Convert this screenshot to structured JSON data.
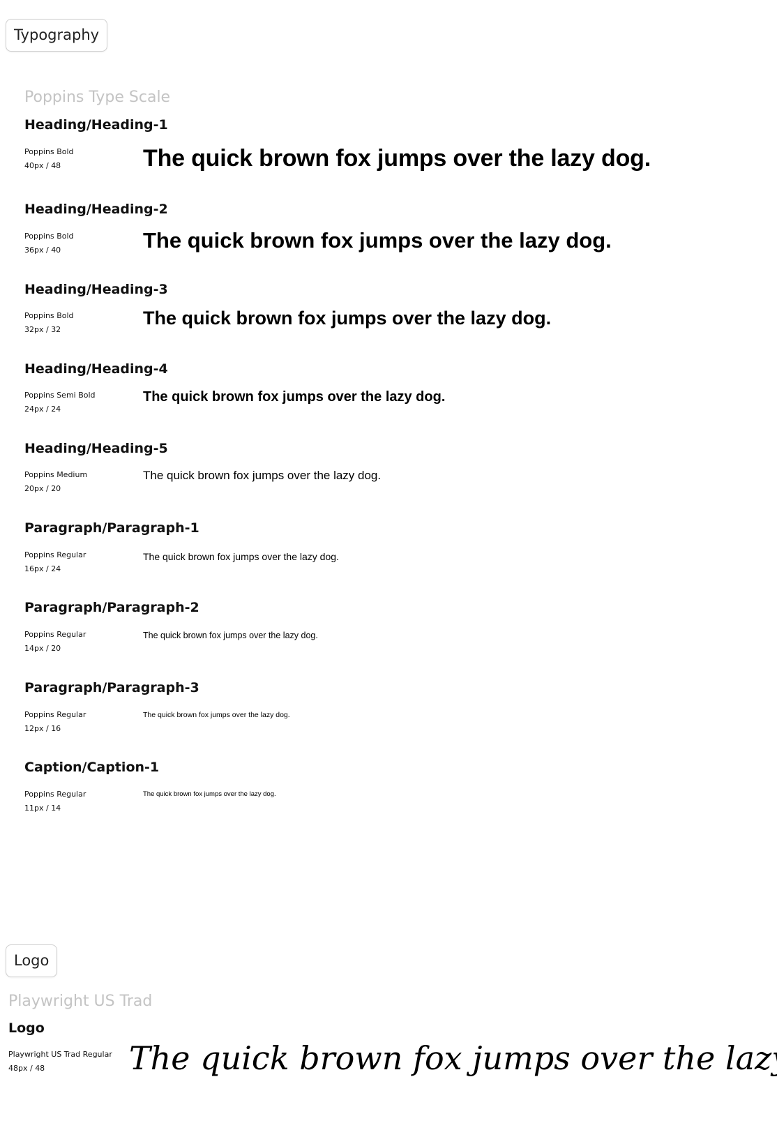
{
  "typography_section": {
    "tag_label": "Typography",
    "subtitle": "Poppins Type Scale",
    "styles": [
      {
        "name": "Heading/Heading-1",
        "font": "Poppins Bold",
        "size": "40px / 48",
        "sample": "The quick brown fox jumps over the lazy dog."
      },
      {
        "name": "Heading/Heading-2",
        "font": "Poppins Bold",
        "size": "36px / 40",
        "sample": "The quick brown fox jumps over the lazy dog."
      },
      {
        "name": "Heading/Heading-3",
        "font": "Poppins Bold",
        "size": "32px / 32",
        "sample": "The quick brown fox jumps over the lazy dog."
      },
      {
        "name": "Heading/Heading-4",
        "font": "Poppins Semi Bold",
        "size": "24px / 24",
        "sample": "The quick brown fox jumps over the lazy dog."
      },
      {
        "name": "Heading/Heading-5",
        "font": "Poppins Medium",
        "size": "20px / 20",
        "sample": "The quick brown fox jumps over the lazy dog."
      },
      {
        "name": "Paragraph/Paragraph-1",
        "font": "Poppins Regular",
        "size": "16px / 24",
        "sample": "The quick brown fox jumps over the lazy dog."
      },
      {
        "name": "Paragraph/Paragraph-2",
        "font": "Poppins Regular",
        "size": "14px / 20",
        "sample": "The quick brown fox jumps over the lazy dog."
      },
      {
        "name": "Paragraph/Paragraph-3",
        "font": "Poppins Regular",
        "size": "12px / 16",
        "sample": "The quick brown fox jumps over the lazy dog."
      },
      {
        "name": "Caption/Caption-1",
        "font": "Poppins Regular",
        "size": "11px / 14",
        "sample": "The quick brown fox jumps over the lazy dog."
      }
    ]
  },
  "logo_section": {
    "tag_label": "Logo",
    "subtitle": "Playwright US Trad",
    "style": {
      "name": "Logo",
      "font": "Playwright US Trad Regular",
      "size": "48px / 48",
      "sample": "The quick brown fox jumps over the lazy dog."
    }
  }
}
